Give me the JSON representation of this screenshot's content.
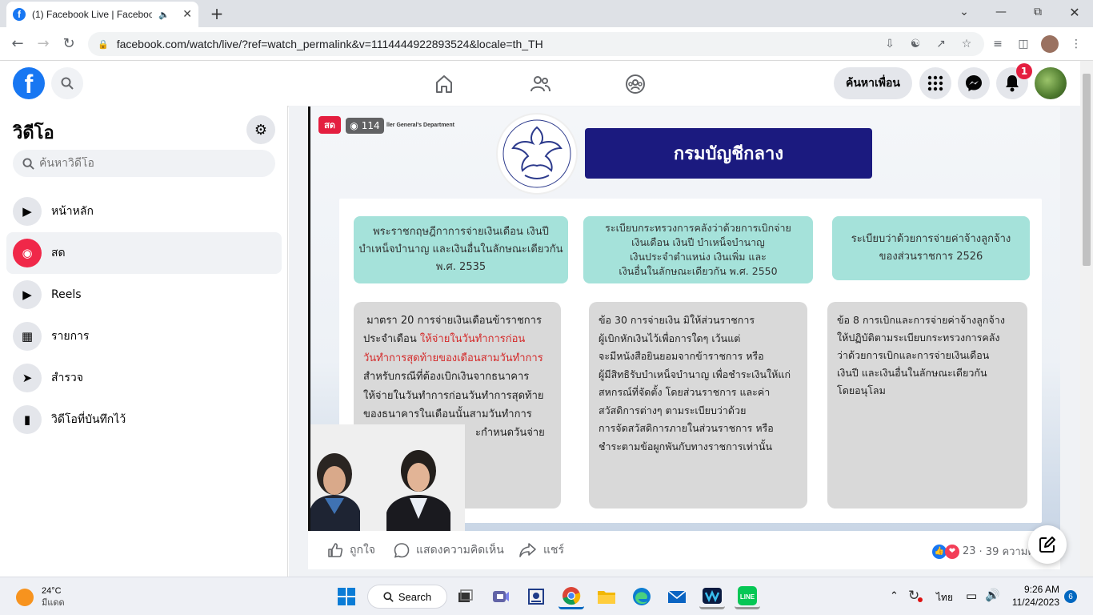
{
  "browser": {
    "tab_title": "(1) Facebook Live | Facebook",
    "url": "facebook.com/watch/live/?ref=watch_permalink&v=1114444922893524&locale=th_TH"
  },
  "header": {
    "logo": "f",
    "find_friends": "ค้นหาเพื่อน",
    "notification_count": "1"
  },
  "sidebar": {
    "title": "วิดีโอ",
    "search_placeholder": "ค้นหาวิดีโอ",
    "items": [
      {
        "label": "หน้าหลัก",
        "icon": "play-icon"
      },
      {
        "label": "สด",
        "icon": "live-icon"
      },
      {
        "label": "Reels",
        "icon": "reels-icon"
      },
      {
        "label": "รายการ",
        "icon": "clapper-icon"
      },
      {
        "label": "สำรวจ",
        "icon": "rocket-icon"
      },
      {
        "label": "วิดีโอที่บันทึกไว้",
        "icon": "bookmark-icon"
      }
    ]
  },
  "video": {
    "live_badge": "สด",
    "viewers": "114",
    "dept_en": "ller General's Department",
    "seal_text": "กรมบัญชีกลาง",
    "banner": "กรมบัญชีกลาง",
    "teal": [
      [
        "พระราชกฤษฎีกาการจ่ายเงินเดือน เงินปี",
        "บำเหน็จบำนาญ และเงินอื่นในลักษณะเดียวกัน",
        "พ.ศ. 2535"
      ],
      [
        "ระเบียบกระทรวงการคลังว่าด้วยการเบิกจ่าย",
        "เงินเดือน เงินปี บำเหน็จบำนาญ",
        "เงินประจำตำแหน่ง เงินเพิ่ม และ",
        "เงินอื่นในลักษณะเดียวกัน พ.ศ. 2550"
      ],
      [
        "ระเบียบว่าด้วยการจ่ายค่าจ้างลูกจ้าง",
        "ของส่วนราชการ 2526"
      ]
    ],
    "gray1": {
      "l1": "มาตรา 20 การจ่ายเงินเดือนข้าราชการ",
      "l2a": "ประจำเดือน ",
      "l2b": "ให้จ่ายในวันทำการก่อน",
      "l3": "วันทำการสุดท้ายของเดือนสามวันทำการ",
      "l4": "สำหรับกรณีที่ต้องเบิกเงินจากธนาคาร",
      "l5": "ให้จ่ายในวันทำการก่อนวันทำการสุดท้าย",
      "l6": "ของธนาคารในเดือนนั้นสามวันทำการ",
      "l7": "ะกำหนดวันจ่าย"
    },
    "gray2": [
      "ข้อ 30 การจ่ายเงิน มิให้ส่วนราชการ",
      "ผู้เบิกหักเงินไว้เพื่อการใดๆ เว้นแต่",
      "จะมีหนังสือยินยอมจากข้าราชการ หรือ",
      "ผู้มีสิทธิรับบำเหน็จบำนาญ เพื่อชำระเงินให้แก่",
      "สหกรณ์ที่จัดตั้ง โดยส่วนราชการ และค่า",
      "สวัสดิการต่างๆ ตามระเบียบว่าด้วย",
      "การจัดสวัสดิการภายในส่วนราชการ หรือ",
      "ชำระตามข้อผูกพันกับทางราชการเท่านั้น"
    ],
    "gray3": [
      "ข้อ 8 การเบิกและการจ่ายค่าจ้างลูกจ้าง",
      "ให้ปฏิบัติตามระเบียบกระทรวงการคลัง",
      "ว่าด้วยการเบิกและการจ่ายเงินเดือน",
      "เงินปี และเงินอื่นในลักษณะเดียวกัน",
      "โดยอนุโลม"
    ]
  },
  "actions": {
    "like": "ถูกใจ",
    "comment": "แสดงความคิดเห็น",
    "share": "แชร์",
    "reaction_count": "23",
    "comments": "· 39 ความคิด"
  },
  "taskbar": {
    "temp": "24°C",
    "weather": "มีแดด",
    "search": "Search",
    "lang": "ไทย",
    "time": "9:26 AM",
    "date": "11/24/2023",
    "notif": "6"
  },
  "colors": {
    "fb_blue": "#1877f2",
    "live_red": "#e41e3f",
    "banner_navy": "#1b1a7f",
    "teal": "#a5e2da"
  }
}
